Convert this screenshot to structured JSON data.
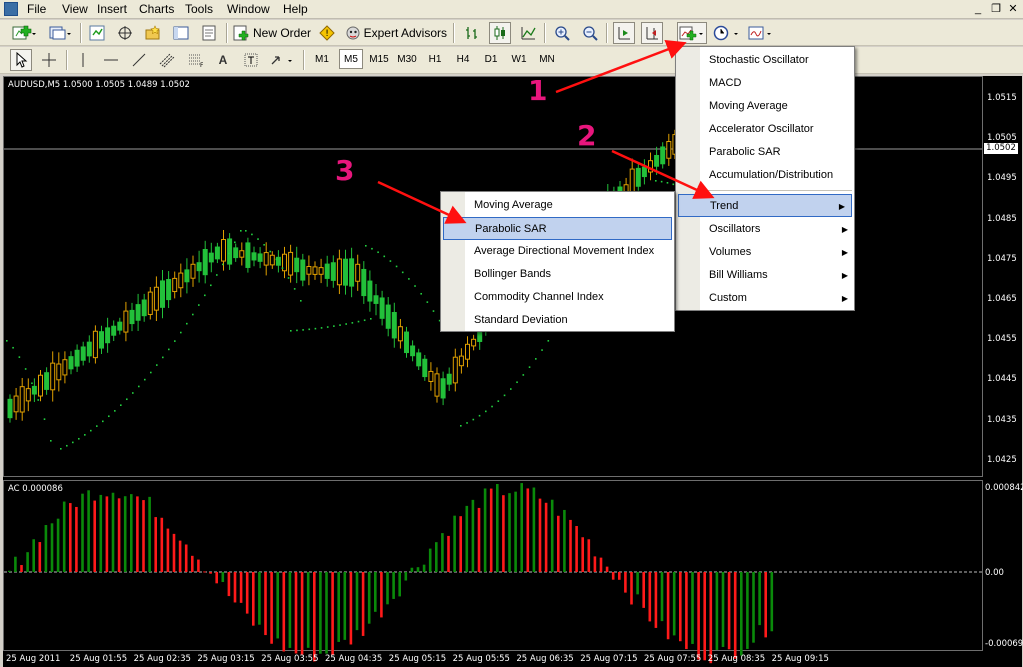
{
  "menubar": {
    "items": [
      "File",
      "View",
      "Insert",
      "Charts",
      "Tools",
      "Window",
      "Help"
    ],
    "window_controls": [
      "_",
      "❐",
      "✕"
    ]
  },
  "toolbar1": {
    "new_order": "New Order",
    "expert_advisors": "Expert Advisors"
  },
  "toolbar2": {
    "timeframes": [
      "M1",
      "M5",
      "M15",
      "M30",
      "H1",
      "H4",
      "D1",
      "W1",
      "MN"
    ],
    "selected_timeframe": "M5",
    "tool_a": "A"
  },
  "chart": {
    "title": "AUDUSD,M5  1.0500 1.0505 1.0489 1.0502",
    "price_axis": [
      "1.0515",
      "1.0505",
      "1.0495",
      "1.0485",
      "1.0475",
      "1.0465",
      "1.0455",
      "1.0445",
      "1.0435",
      "1.0425"
    ],
    "current_price": "1.0502",
    "indicator_title": "AC 0.000086",
    "ac_axis": [
      "0.000842",
      "0.00",
      "-0.00069"
    ],
    "time_axis": [
      "25 Aug 2011",
      "25 Aug 01:55",
      "25 Aug 02:35",
      "25 Aug 03:15",
      "25 Aug 03:55",
      "25 Aug 04:35",
      "25 Aug 05:15",
      "25 Aug 05:55",
      "25 Aug 06:35",
      "25 Aug 07:15",
      "25 Aug 07:55",
      "25 Aug 08:35",
      "25 Aug 09:15"
    ],
    "colors": {
      "bull": "#22c03a",
      "bear": "#000000",
      "bull_border": "#22c03a",
      "bear_border": "#e0a000",
      "ac_up": "#0a8a0a",
      "ac_down": "#ff1a1a",
      "sar": "#22d040"
    }
  },
  "menu_indicators": {
    "items": [
      {
        "label": "Stochastic Oscillator",
        "submenu": false
      },
      {
        "label": "MACD",
        "submenu": false
      },
      {
        "label": "Moving Average",
        "submenu": false
      },
      {
        "label": "Accelerator Oscillator",
        "submenu": false
      },
      {
        "label": "Parabolic SAR",
        "submenu": false
      },
      {
        "label": "Accumulation/Distribution",
        "submenu": false
      },
      {
        "label": "Trend",
        "submenu": true
      },
      {
        "label": "Oscillators",
        "submenu": true
      },
      {
        "label": "Volumes",
        "submenu": true
      },
      {
        "label": "Bill Williams",
        "submenu": true
      },
      {
        "label": "Custom",
        "submenu": true
      }
    ],
    "highlighted": "Trend"
  },
  "menu_trend": {
    "items": [
      "Moving Average",
      "Parabolic SAR",
      "Average Directional Movement Index",
      "Bollinger Bands",
      "Commodity Channel Index",
      "Standard Deviation"
    ],
    "highlighted": "Parabolic SAR"
  },
  "annotations": [
    "1",
    "2",
    "3"
  ]
}
